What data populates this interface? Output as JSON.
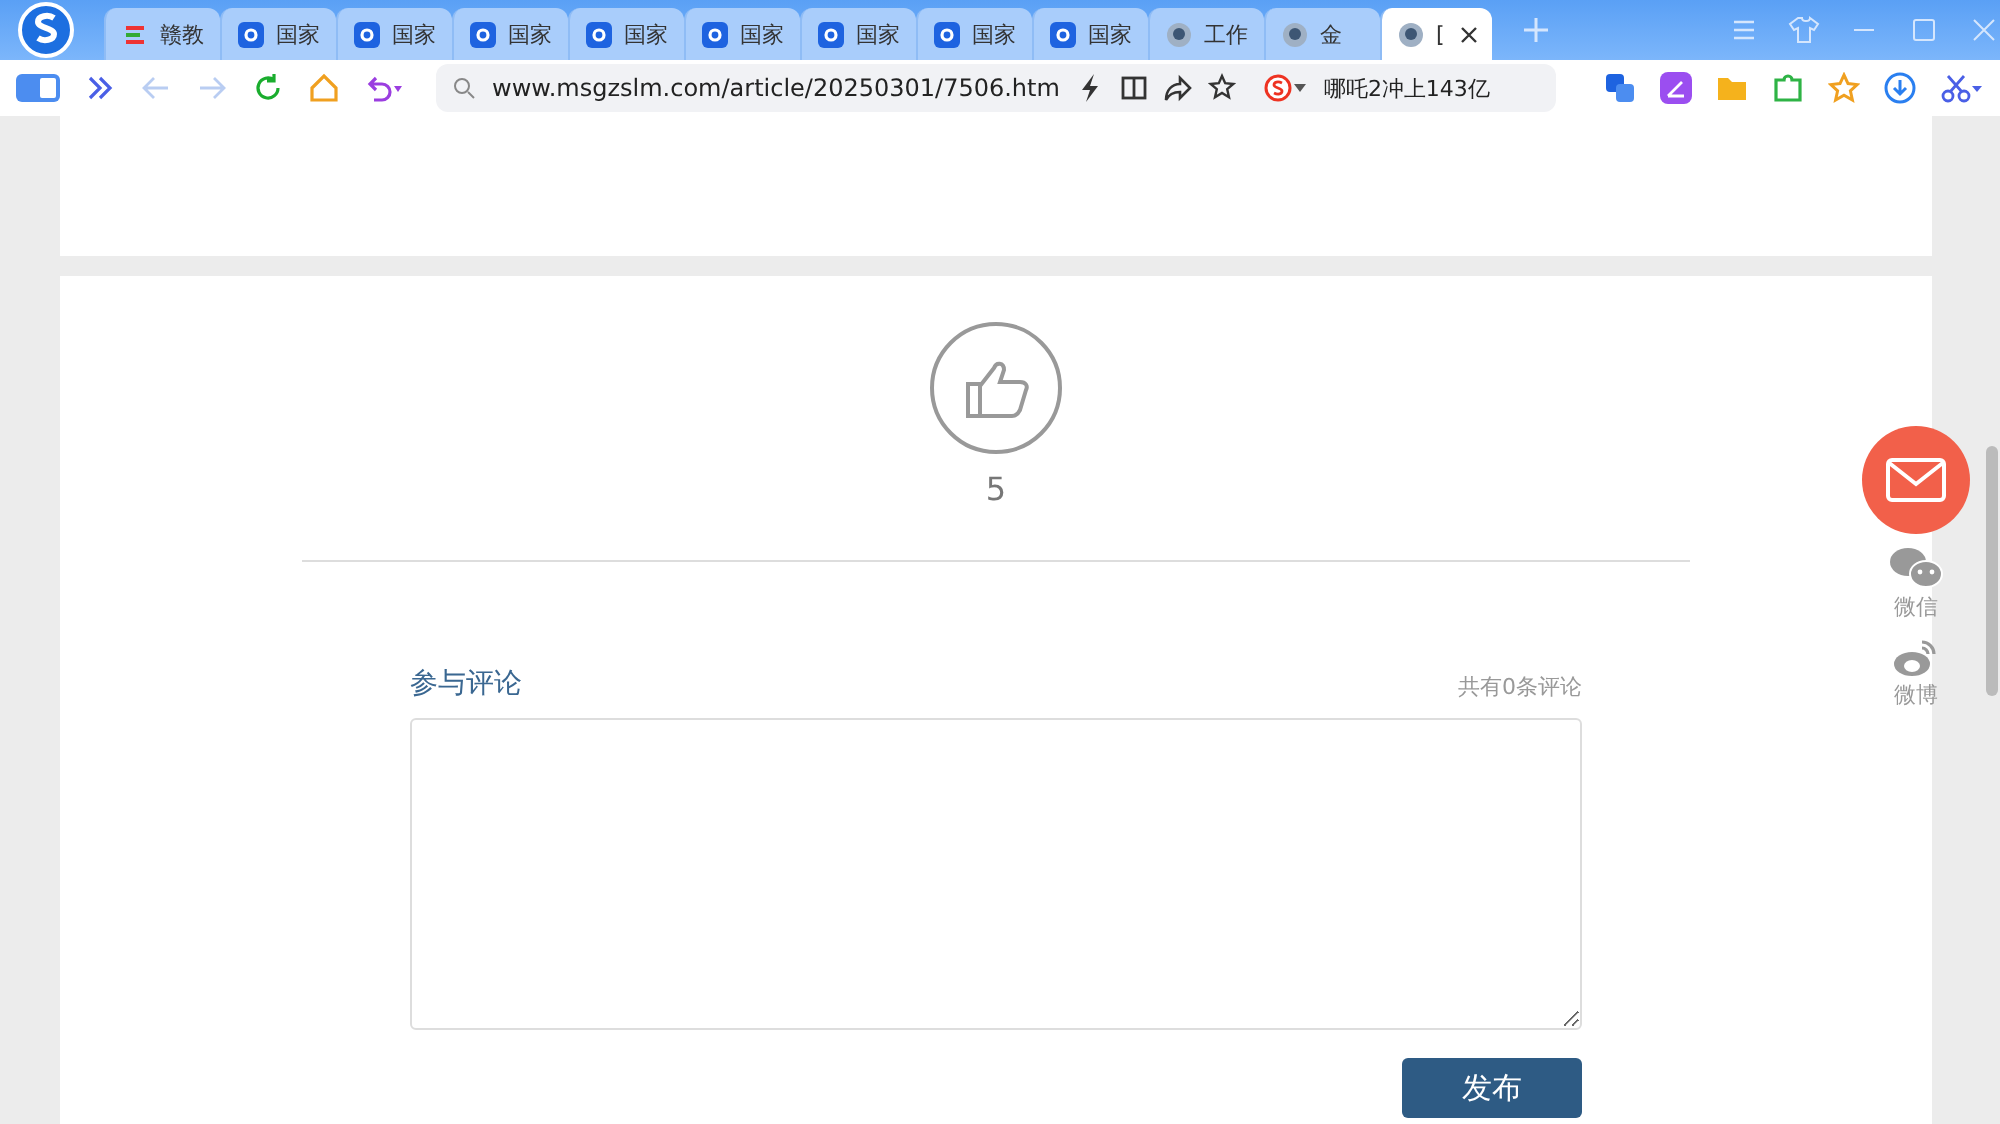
{
  "tabs": [
    {
      "title": "赣教",
      "kind": "colorful",
      "selected": false
    },
    {
      "title": "国家",
      "kind": "blue",
      "selected": false
    },
    {
      "title": "国家",
      "kind": "blue",
      "selected": false
    },
    {
      "title": "国家",
      "kind": "blue",
      "selected": false
    },
    {
      "title": "国家",
      "kind": "blue",
      "selected": false
    },
    {
      "title": "国家",
      "kind": "blue",
      "selected": false
    },
    {
      "title": "国家",
      "kind": "blue",
      "selected": false
    },
    {
      "title": "国家",
      "kind": "blue",
      "selected": false
    },
    {
      "title": "国家",
      "kind": "blue",
      "selected": false
    },
    {
      "title": "工作",
      "kind": "globe",
      "selected": false
    },
    {
      "title": "金",
      "kind": "globe",
      "selected": false
    },
    {
      "title": "[",
      "kind": "globe",
      "selected": true
    }
  ],
  "address": {
    "url": "www.msgzslm.com/article/20250301/7506.htm"
  },
  "search": {
    "value": "哪吒2冲上143亿"
  },
  "likes": {
    "count": "5"
  },
  "comments": {
    "title": "参与评论",
    "count": "共有0条评论",
    "submit": "发布"
  },
  "share": [
    {
      "kind": "wechat",
      "label": "微信"
    },
    {
      "kind": "weibo",
      "label": "微博"
    }
  ]
}
